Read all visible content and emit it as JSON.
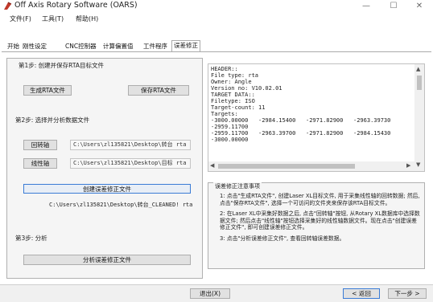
{
  "window": {
    "title": "Off Axis Rotary Software (OARS)",
    "controls": [
      "—",
      "☐",
      "✕"
    ]
  },
  "menu": [
    "文件(F)",
    "工具(T)",
    "帮助(H)"
  ],
  "tabs": [
    "开始",
    "刚性设定",
    "CNC控制器",
    "计算偏置值",
    "工件程序",
    "误差修正"
  ],
  "step1": {
    "title": "第1步: 创建并保存RTA目标文件",
    "generate_button": "生成RTA文件",
    "save_button": "保存RTA文件"
  },
  "step2": {
    "title": "第2步: 选择并分析数据文件",
    "rotary_button": "回转轴",
    "linear_button": "线性轴",
    "rotary_path": "C:\\Users\\zl135821\\Desktop\\转台 rta",
    "linear_path": "C:\\Users\\zl135821\\Desktop\\目标 rta",
    "create_button": "创建误差修正文件",
    "output_path": "C:\\Users\\zl135821\\Desktop\\转台_CLEANED! rta"
  },
  "step3": {
    "title": "第3步: 分析",
    "analyze_button": "分析误差修正文件"
  },
  "file_preview": {
    "lines": [
      "HEADER::",
      "File type: rta",
      "Owner: Angle",
      "Version no: V10.02.01",
      "",
      "TARGET DATA::",
      "Filetype: ISO",
      "Target-count: 11",
      "Targets:",
      "-3000.00000   -2984.15400   -2971.82900   -2963.39730",
      "-2959.11700",
      "-2959.11700   -2963.39700   -2971.82900   -2984.15430",
      "-3000.00000"
    ]
  },
  "notes": {
    "title": "误差修正注意事项",
    "items": [
      "1: 点击\"生成RTA文件\", 创建Laser XL目标文件, 用于采集线性轴的回转数据; 然后, 点击\"保存RTA文件\", 选择一个可访问的文件夹来保存该RTA目标文件。",
      "2: 在Laser XL中采集好数据之后, 点击\"回转轴\"按钮, 从Rotary XL数据库中选择数据文件; 然后点击\"线性轴\"按钮选择采集好的线性轴数据文件。现在点击\"创建误差修正文件\", 即可创建误差修正文件。",
      "3: 点击\"分析误差修正文件\", 查看回转轴误差数据。"
    ]
  },
  "footer": {
    "exit_button": "退出(X)",
    "back_button": "< 返回",
    "next_button": "下一步 >"
  }
}
